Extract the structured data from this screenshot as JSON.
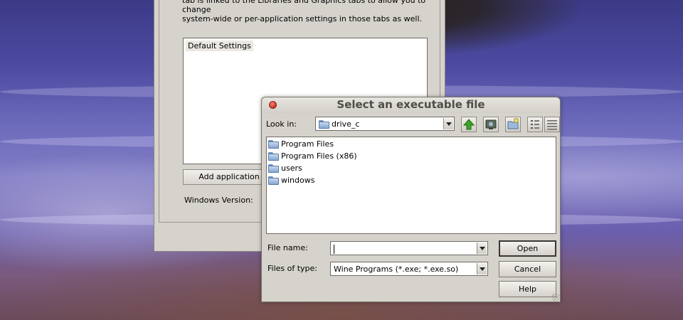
{
  "background_window": {
    "description_text": "tab is linked to the Libraries and Graphics tabs to allow you to change\nsystem-wide or per-application settings in those tabs as well.",
    "applications": [
      "Default Settings"
    ],
    "add_app_button": "Add application",
    "windows_version_label": "Windows Version:"
  },
  "dialog": {
    "title": "Select an executable file",
    "look_in_label": "Look in:",
    "look_in_value": "drive_c",
    "toolbar": [
      "up-folder-icon",
      "desktop-icon",
      "new-folder-icon",
      "list-view-icon",
      "details-view-icon"
    ],
    "files": [
      "Program Files",
      "Program Files (x86)",
      "users",
      "windows"
    ],
    "file_name_label": "File name:",
    "file_name_value": "",
    "file_type_label": "Files of type:",
    "file_type_value": "Wine Programs (*.exe; *.exe.so)",
    "buttons": {
      "open": "Open",
      "cancel": "Cancel",
      "help": "Help"
    }
  },
  "colors": {
    "dialog_bg": "#d6d2cc",
    "title_text": "#4f4d4a",
    "close_button": "#d23a28",
    "up_arrow": "#3fa12a"
  }
}
